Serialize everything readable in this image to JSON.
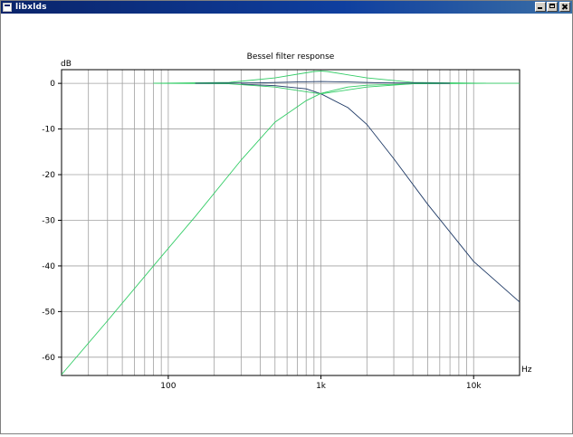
{
  "window": {
    "title": "libxlds"
  },
  "chart_data": {
    "type": "line",
    "title": "Bessel filter response",
    "ylabel": "dB",
    "xlabel": "Hz",
    "x_scale": "log",
    "xlim": [
      20,
      20000
    ],
    "ylim": [
      -64,
      3
    ],
    "y_ticks": [
      0,
      -10,
      -20,
      -30,
      -40,
      -50,
      -60
    ],
    "y_tick_labels": [
      "0",
      "-10",
      "-20",
      "-30",
      "-40",
      "-50",
      "-60"
    ],
    "x_tick_values": [
      100,
      1000,
      10000
    ],
    "x_tick_labels": [
      "100",
      "1k",
      "10k"
    ],
    "grid": true,
    "series": [
      {
        "color": "#33cc66",
        "x": [
          20,
          40,
          80,
          150,
          300,
          500,
          800,
          1000,
          1500,
          2000,
          4000,
          8000,
          20000
        ],
        "values": [
          -63.8,
          -52.0,
          -40.0,
          -29.2,
          -16.8,
          -8.5,
          -3.8,
          -2.2,
          -0.8,
          -0.4,
          -0.1,
          0,
          0
        ]
      },
      {
        "color": "#1f3a66",
        "x": [
          300,
          500,
          800,
          1000,
          1500,
          2000,
          3000,
          5000,
          10000,
          20000
        ],
        "values": [
          -0.2,
          -0.5,
          -1.2,
          -2.3,
          -5.3,
          -9.0,
          -16.5,
          -26.5,
          -39.0,
          -47.9
        ]
      },
      {
        "color": "#33cc66",
        "x": [
          80,
          250,
          500,
          900,
          1000,
          1100,
          2000,
          4000,
          12000
        ],
        "values": [
          0,
          0.2,
          1.2,
          2.6,
          2.7,
          2.6,
          1.2,
          0.2,
          0
        ]
      },
      {
        "color": "#33cc66",
        "x": [
          80,
          250,
          500,
          900,
          1000,
          1100,
          2000,
          4000,
          12000
        ],
        "values": [
          0,
          -0.1,
          -0.8,
          -2.1,
          -2.3,
          -2.1,
          -0.8,
          -0.1,
          0
        ]
      },
      {
        "color": "#1f3a66",
        "x": [
          150,
          400,
          700,
          1000,
          1500,
          2500,
          7000
        ],
        "values": [
          0,
          0.1,
          0.3,
          0.4,
          0.3,
          0.1,
          0
        ]
      }
    ]
  }
}
